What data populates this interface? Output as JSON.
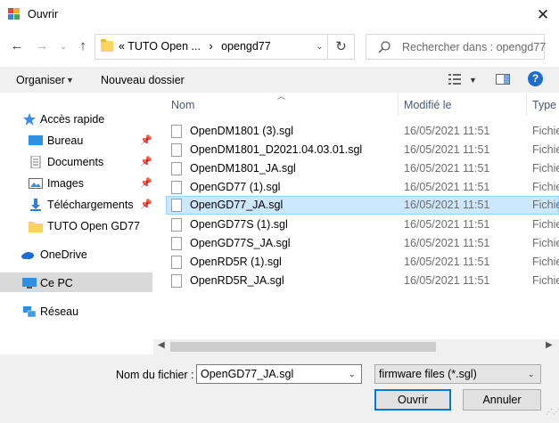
{
  "window": {
    "title": "Ouvrir",
    "close_symbol": "✕"
  },
  "nav": {
    "address_prefix": "«",
    "address_parts": [
      "TUTO Open ...",
      "opengd77"
    ],
    "address_separator": "›",
    "search_placeholder": "Rechercher dans : opengd77"
  },
  "toolbar": {
    "organiser": "Organiser",
    "nouveau_dossier": "Nouveau dossier",
    "help": "?"
  },
  "sidebar": {
    "items": [
      {
        "label": "Accès rapide",
        "icon": "star-icon"
      },
      {
        "label": "Bureau",
        "icon": "desktop-icon",
        "pinned": true
      },
      {
        "label": "Documents",
        "icon": "documents-icon",
        "pinned": true
      },
      {
        "label": "Images",
        "icon": "images-icon",
        "pinned": true
      },
      {
        "label": "Téléchargements",
        "icon": "download-icon",
        "pinned": true
      },
      {
        "label": "TUTO Open GD77",
        "icon": "folder-icon"
      },
      {
        "label": "OneDrive",
        "icon": "cloud-icon"
      },
      {
        "label": "Ce PC",
        "icon": "pc-icon",
        "selected": true
      },
      {
        "label": "Réseau",
        "icon": "network-icon"
      }
    ]
  },
  "file_list": {
    "columns": {
      "name": "Nom",
      "modified": "Modifié le",
      "type": "Type"
    },
    "rows": [
      {
        "name": "OpenDM1801 (3).sgl",
        "modified": "16/05/2021 11:51",
        "type": "Fichie"
      },
      {
        "name": "OpenDM1801_D2021.04.03.01.sgl",
        "modified": "16/05/2021 11:51",
        "type": "Fichie"
      },
      {
        "name": "OpenDM1801_JA.sgl",
        "modified": "16/05/2021 11:51",
        "type": "Fichie"
      },
      {
        "name": "OpenGD77 (1).sgl",
        "modified": "16/05/2021 11:51",
        "type": "Fichie"
      },
      {
        "name": "OpenGD77_JA.sgl",
        "modified": "16/05/2021 11:51",
        "type": "Fichie",
        "selected": true
      },
      {
        "name": "OpenGD77S (1).sgl",
        "modified": "16/05/2021 11:51",
        "type": "Fichie"
      },
      {
        "name": "OpenGD77S_JA.sgl",
        "modified": "16/05/2021 11:51",
        "type": "Fichie"
      },
      {
        "name": "OpenRD5R (1).sgl",
        "modified": "16/05/2021 11:51",
        "type": "Fichie"
      },
      {
        "name": "OpenRD5R_JA.sgl",
        "modified": "16/05/2021 11:51",
        "type": "Fichie"
      }
    ]
  },
  "footer": {
    "filename_label": "Nom du fichier :",
    "filename_value": "OpenGD77_JA.sgl",
    "filetype_value": "firmware files (*.sgl)",
    "open_button": "Ouvrir",
    "cancel_button": "Annuler"
  },
  "colors": {
    "accent": "#0078d7",
    "selection": "#cce8ff",
    "header_text": "#4b5a73"
  }
}
